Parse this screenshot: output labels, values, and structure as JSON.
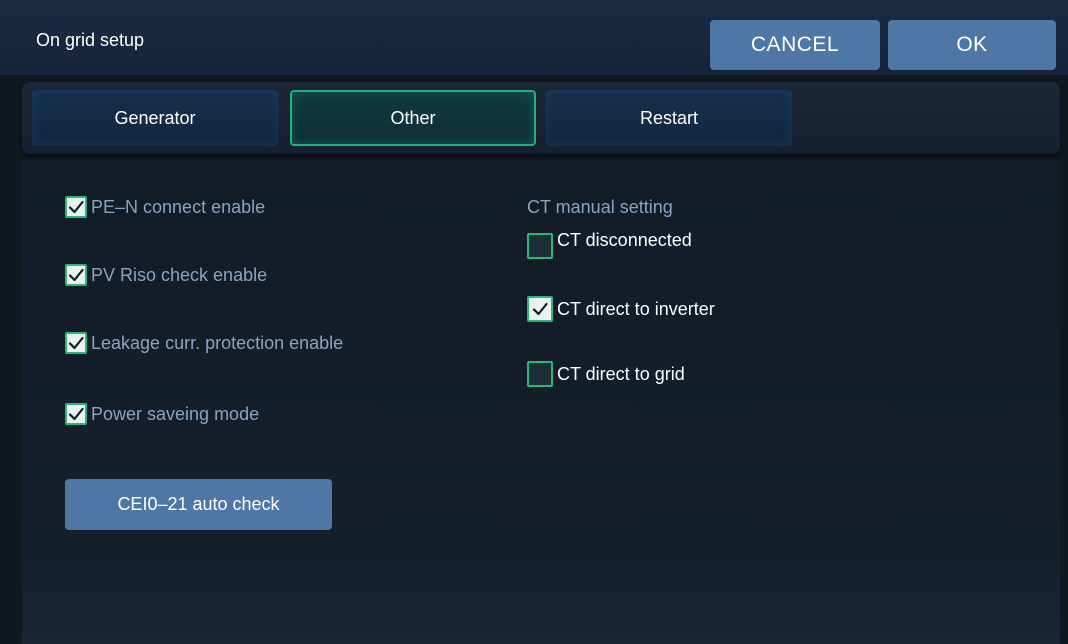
{
  "header": {
    "title": "On grid setup",
    "cancel_label": "CANCEL",
    "ok_label": "OK"
  },
  "tabs": [
    {
      "label": "Generator",
      "active": false
    },
    {
      "label": "Other",
      "active": true
    },
    {
      "label": "Restart",
      "active": false
    }
  ],
  "left_options": [
    {
      "label": "PE–N connect enable",
      "checked": true
    },
    {
      "label": "PV Riso check enable",
      "checked": true
    },
    {
      "label": "Leakage curr. protection enable",
      "checked": true
    },
    {
      "label": "Power saveing mode",
      "checked": true
    }
  ],
  "ct": {
    "section_title": "CT manual setting",
    "options": [
      {
        "label": "CT disconnected",
        "checked": false
      },
      {
        "label": "CT direct to inverter",
        "checked": true
      },
      {
        "label": "CT direct to grid",
        "checked": false
      }
    ]
  },
  "actions": {
    "auto_check_label": "CEI0–21 auto check"
  },
  "colors": {
    "accent_green": "#29b879",
    "button_blue": "#4f77a5",
    "label_blue": "#8ca3c0"
  }
}
